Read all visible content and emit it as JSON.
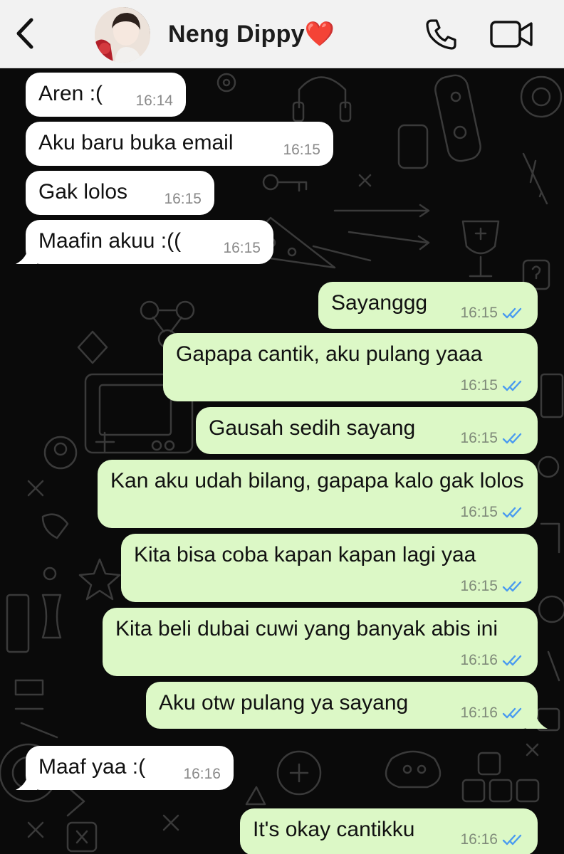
{
  "header": {
    "contact_name": "Neng Dippy❤️",
    "back_icon": "chevron-left-icon",
    "call_icon": "phone-icon",
    "video_icon": "video-camera-icon",
    "background_color": "#f2f2f2"
  },
  "colors": {
    "incoming_bubble": "#ffffff",
    "outgoing_bubble": "#dcf8c6",
    "read_tick": "#4a9bf0",
    "chat_background": "#0a0a0a"
  },
  "messages": [
    {
      "direction": "in",
      "text": "Aren :(",
      "time": "16:14"
    },
    {
      "direction": "in",
      "text": "Aku baru buka email",
      "time": "16:15"
    },
    {
      "direction": "in",
      "text": "Gak lolos",
      "time": "16:15"
    },
    {
      "direction": "in",
      "text": "Maafin akuu :((",
      "time": "16:15"
    },
    {
      "direction": "out",
      "text": "Sayanggg",
      "time": "16:15",
      "status": "read"
    },
    {
      "direction": "out",
      "text": "Gapapa cantik, aku pulang yaaa",
      "time": "16:15",
      "status": "read"
    },
    {
      "direction": "out",
      "text": "Gausah sedih sayang",
      "time": "16:15",
      "status": "read"
    },
    {
      "direction": "out",
      "text": "Kan aku udah bilang, gapapa kalo gak lolos",
      "time": "16:15",
      "status": "read"
    },
    {
      "direction": "out",
      "text": "Kita bisa coba kapan kapan lagi yaa",
      "time": "16:15",
      "status": "read"
    },
    {
      "direction": "out",
      "text": "Kita beli dubai cuwi yang banyak abis ini",
      "time": "16:16",
      "status": "read"
    },
    {
      "direction": "out",
      "text": "Aku otw pulang ya sayang",
      "time": "16:16",
      "status": "read"
    },
    {
      "direction": "in",
      "text": "Maaf yaa :(",
      "time": "16:16"
    },
    {
      "direction": "out",
      "text": "It's okay cantikku",
      "time": "16:16",
      "status": "read"
    }
  ]
}
